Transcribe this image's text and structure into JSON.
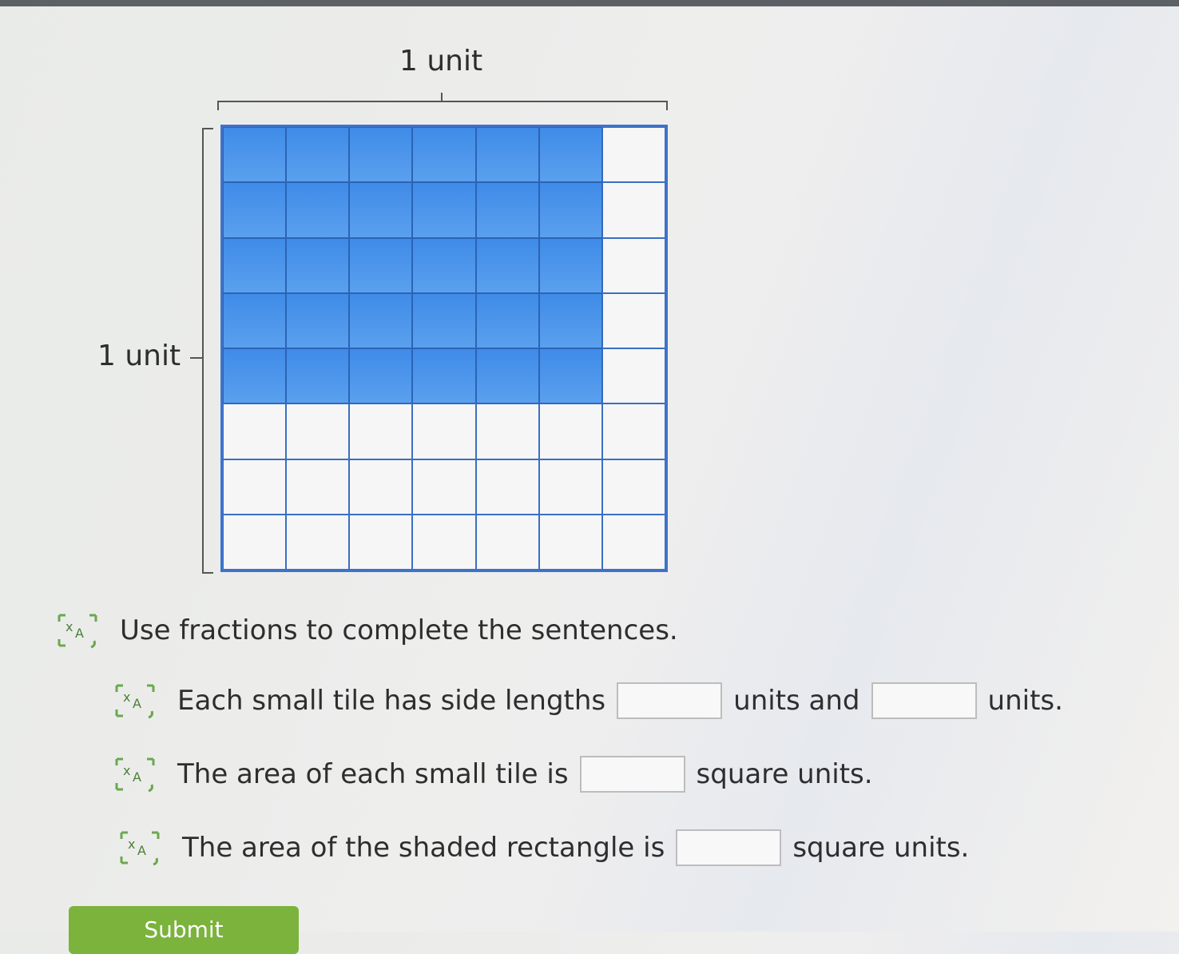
{
  "diagram": {
    "top_label": "1 unit",
    "side_label": "1 unit",
    "grid_columns": 7,
    "grid_rows": 8,
    "shaded_columns": 6,
    "shaded_rows": 5,
    "shade_color": "#4a93ec",
    "grid_line_color": "#3a6fc2"
  },
  "instruction": {
    "icon": "text-to-speech-icon",
    "text": "Use fractions to complete the sentences."
  },
  "sentences": [
    {
      "icon": "text-to-speech-icon",
      "part1": "Each small tile has side lengths",
      "part2": "units and",
      "part3": "units.",
      "input1_value": "",
      "input2_value": ""
    },
    {
      "icon": "text-to-speech-icon",
      "part1": "The area of each small tile is",
      "part2": "square units.",
      "input1_value": ""
    },
    {
      "icon": "text-to-speech-icon",
      "part1": "The area of the shaded rectangle is",
      "part2": "square units.",
      "input1_value": ""
    }
  ],
  "submit": {
    "label": "Submit",
    "color": "#7bb33c"
  }
}
